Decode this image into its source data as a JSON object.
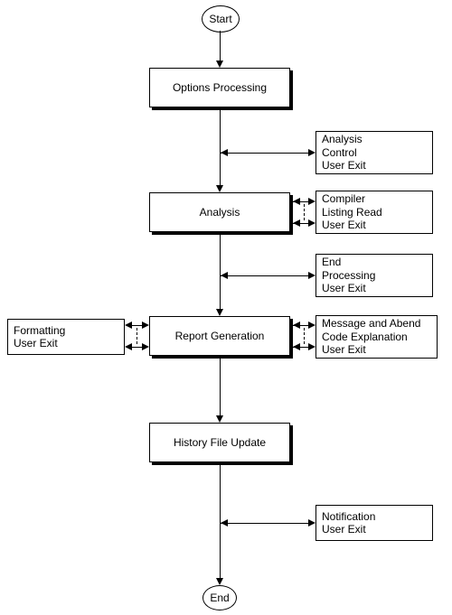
{
  "terminals": {
    "start": "Start",
    "end": "End"
  },
  "processes": {
    "options": "Options Processing",
    "analysis": "Analysis",
    "report": "Report Generation",
    "history": "History File Update"
  },
  "exits": {
    "analysis_control": {
      "l1": "Analysis",
      "l2": "Control",
      "l3": "User Exit"
    },
    "compiler_listing": {
      "l1": "Compiler",
      "l2": "Listing Read",
      "l3": "User Exit"
    },
    "end_processing": {
      "l1": "End",
      "l2": "Processing",
      "l3": "User Exit"
    },
    "formatting": {
      "l1": "Formatting",
      "l2": "User Exit"
    },
    "message_abend": {
      "l1": "Message and Abend",
      "l2": "Code Explanation",
      "l3": "User Exit"
    },
    "notification": {
      "l1": "Notification",
      "l2": "User Exit"
    }
  },
  "chart_data": {
    "type": "flowchart",
    "nodes": [
      {
        "id": "start",
        "kind": "terminal",
        "label": "Start"
      },
      {
        "id": "options",
        "kind": "process",
        "label": "Options Processing"
      },
      {
        "id": "analysis",
        "kind": "process",
        "label": "Analysis"
      },
      {
        "id": "report",
        "kind": "process",
        "label": "Report Generation"
      },
      {
        "id": "history",
        "kind": "process",
        "label": "History File Update"
      },
      {
        "id": "end",
        "kind": "terminal",
        "label": "End"
      },
      {
        "id": "ex_analysis_control",
        "kind": "exit",
        "label": "Analysis Control User Exit"
      },
      {
        "id": "ex_compiler_listing",
        "kind": "exit",
        "label": "Compiler Listing Read User Exit"
      },
      {
        "id": "ex_end_processing",
        "kind": "exit",
        "label": "End Processing User Exit"
      },
      {
        "id": "ex_formatting",
        "kind": "exit",
        "label": "Formatting User Exit"
      },
      {
        "id": "ex_message_abend",
        "kind": "exit",
        "label": "Message and Abend Code Explanation User Exit"
      },
      {
        "id": "ex_notification",
        "kind": "exit",
        "label": "Notification User Exit"
      }
    ],
    "edges": [
      {
        "from": "start",
        "to": "options",
        "style": "solid",
        "dir": "forward"
      },
      {
        "from": "options",
        "to": "analysis",
        "style": "solid",
        "dir": "forward"
      },
      {
        "from": "analysis",
        "to": "report",
        "style": "solid",
        "dir": "forward"
      },
      {
        "from": "report",
        "to": "history",
        "style": "solid",
        "dir": "forward"
      },
      {
        "from": "history",
        "to": "end",
        "style": "solid",
        "dir": "forward"
      },
      {
        "from": "options-to-analysis",
        "to": "ex_analysis_control",
        "style": "solid",
        "dir": "both"
      },
      {
        "from": "analysis",
        "to": "ex_compiler_listing",
        "style": "solid",
        "dir": "both"
      },
      {
        "from": "analysis",
        "to": "ex_compiler_listing",
        "style": "dashed",
        "dir": "both"
      },
      {
        "from": "analysis-to-report",
        "to": "ex_end_processing",
        "style": "solid",
        "dir": "both"
      },
      {
        "from": "report",
        "to": "ex_formatting",
        "style": "solid",
        "dir": "both"
      },
      {
        "from": "report",
        "to": "ex_formatting",
        "style": "dashed",
        "dir": "both"
      },
      {
        "from": "report",
        "to": "ex_message_abend",
        "style": "solid",
        "dir": "both"
      },
      {
        "from": "report",
        "to": "ex_message_abend",
        "style": "dashed",
        "dir": "both"
      },
      {
        "from": "history-to-end",
        "to": "ex_notification",
        "style": "solid",
        "dir": "both"
      }
    ]
  }
}
